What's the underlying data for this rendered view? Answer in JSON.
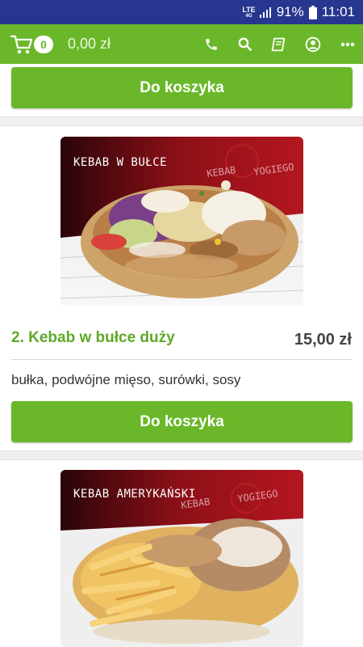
{
  "status_bar": {
    "network": "LTE",
    "network_sub": "4G",
    "battery": "91%",
    "time": "11:01"
  },
  "app_bar": {
    "cart_count": "0",
    "cart_total": "0,00 zł",
    "icons": [
      "cart-icon",
      "phone-icon",
      "search-icon",
      "menu-book-icon",
      "account-icon",
      "more-icon"
    ],
    "color": "#6ab82a"
  },
  "products": [
    {
      "button_label": "Do koszyka"
    },
    {
      "image_label": "KEBAB W BUŁCE",
      "brand": "KEBAB YOGIEGO",
      "title": "2. Kebab w bułce duży",
      "price": "15,00 zł",
      "description": "bułka, podwójne mięso, surówki, sosy",
      "button_label": "Do koszyka"
    },
    {
      "image_label": "KEBAB AMERYKAŃSKI",
      "brand": "KEBAB YOGIEGO"
    }
  ],
  "colors": {
    "accent": "#6ab82a",
    "status_bar": "#27368f",
    "title_text": "#5fa82a"
  }
}
